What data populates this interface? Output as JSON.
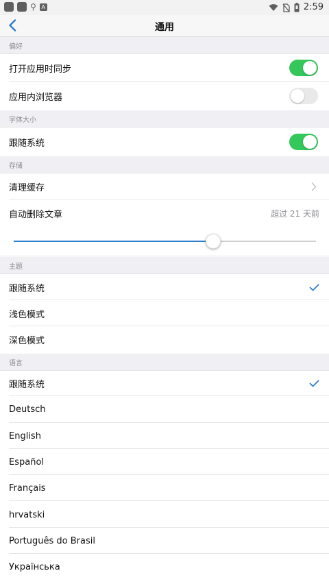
{
  "status_bar": {
    "time": "2:59"
  },
  "nav": {
    "title": "通用"
  },
  "sections": {
    "sync": {
      "header": "偏好",
      "rows": [
        {
          "label": "打开应用时同步",
          "toggle_on": true
        },
        {
          "label": "应用内浏览器",
          "toggle_on": false
        }
      ]
    },
    "font": {
      "header": "字体大小",
      "rows": [
        {
          "label": "跟随系统",
          "toggle_on": true
        }
      ]
    },
    "storage": {
      "header": "存储",
      "clear_cache": "清理缓存",
      "auto_delete_label": "自动删除文章",
      "auto_delete_value": "超过 21 天前",
      "auto_delete_slider_fraction": 0.66
    },
    "theme": {
      "header": "主题",
      "options": [
        "跟随系统",
        "浅色模式",
        "深色模式"
      ],
      "selected_index": 0
    },
    "language": {
      "header": "语言",
      "options": [
        "跟随系统",
        "Deutsch",
        "English",
        "Español",
        "Français",
        "hrvatski",
        "Português do Brasil",
        "Українська"
      ],
      "selected_index": 0
    }
  },
  "colors": {
    "accent": "#2d7fd0",
    "toggle_on": "#34c759",
    "toggle_off": "#e9e9ea",
    "header_bg": "#efeff4"
  }
}
